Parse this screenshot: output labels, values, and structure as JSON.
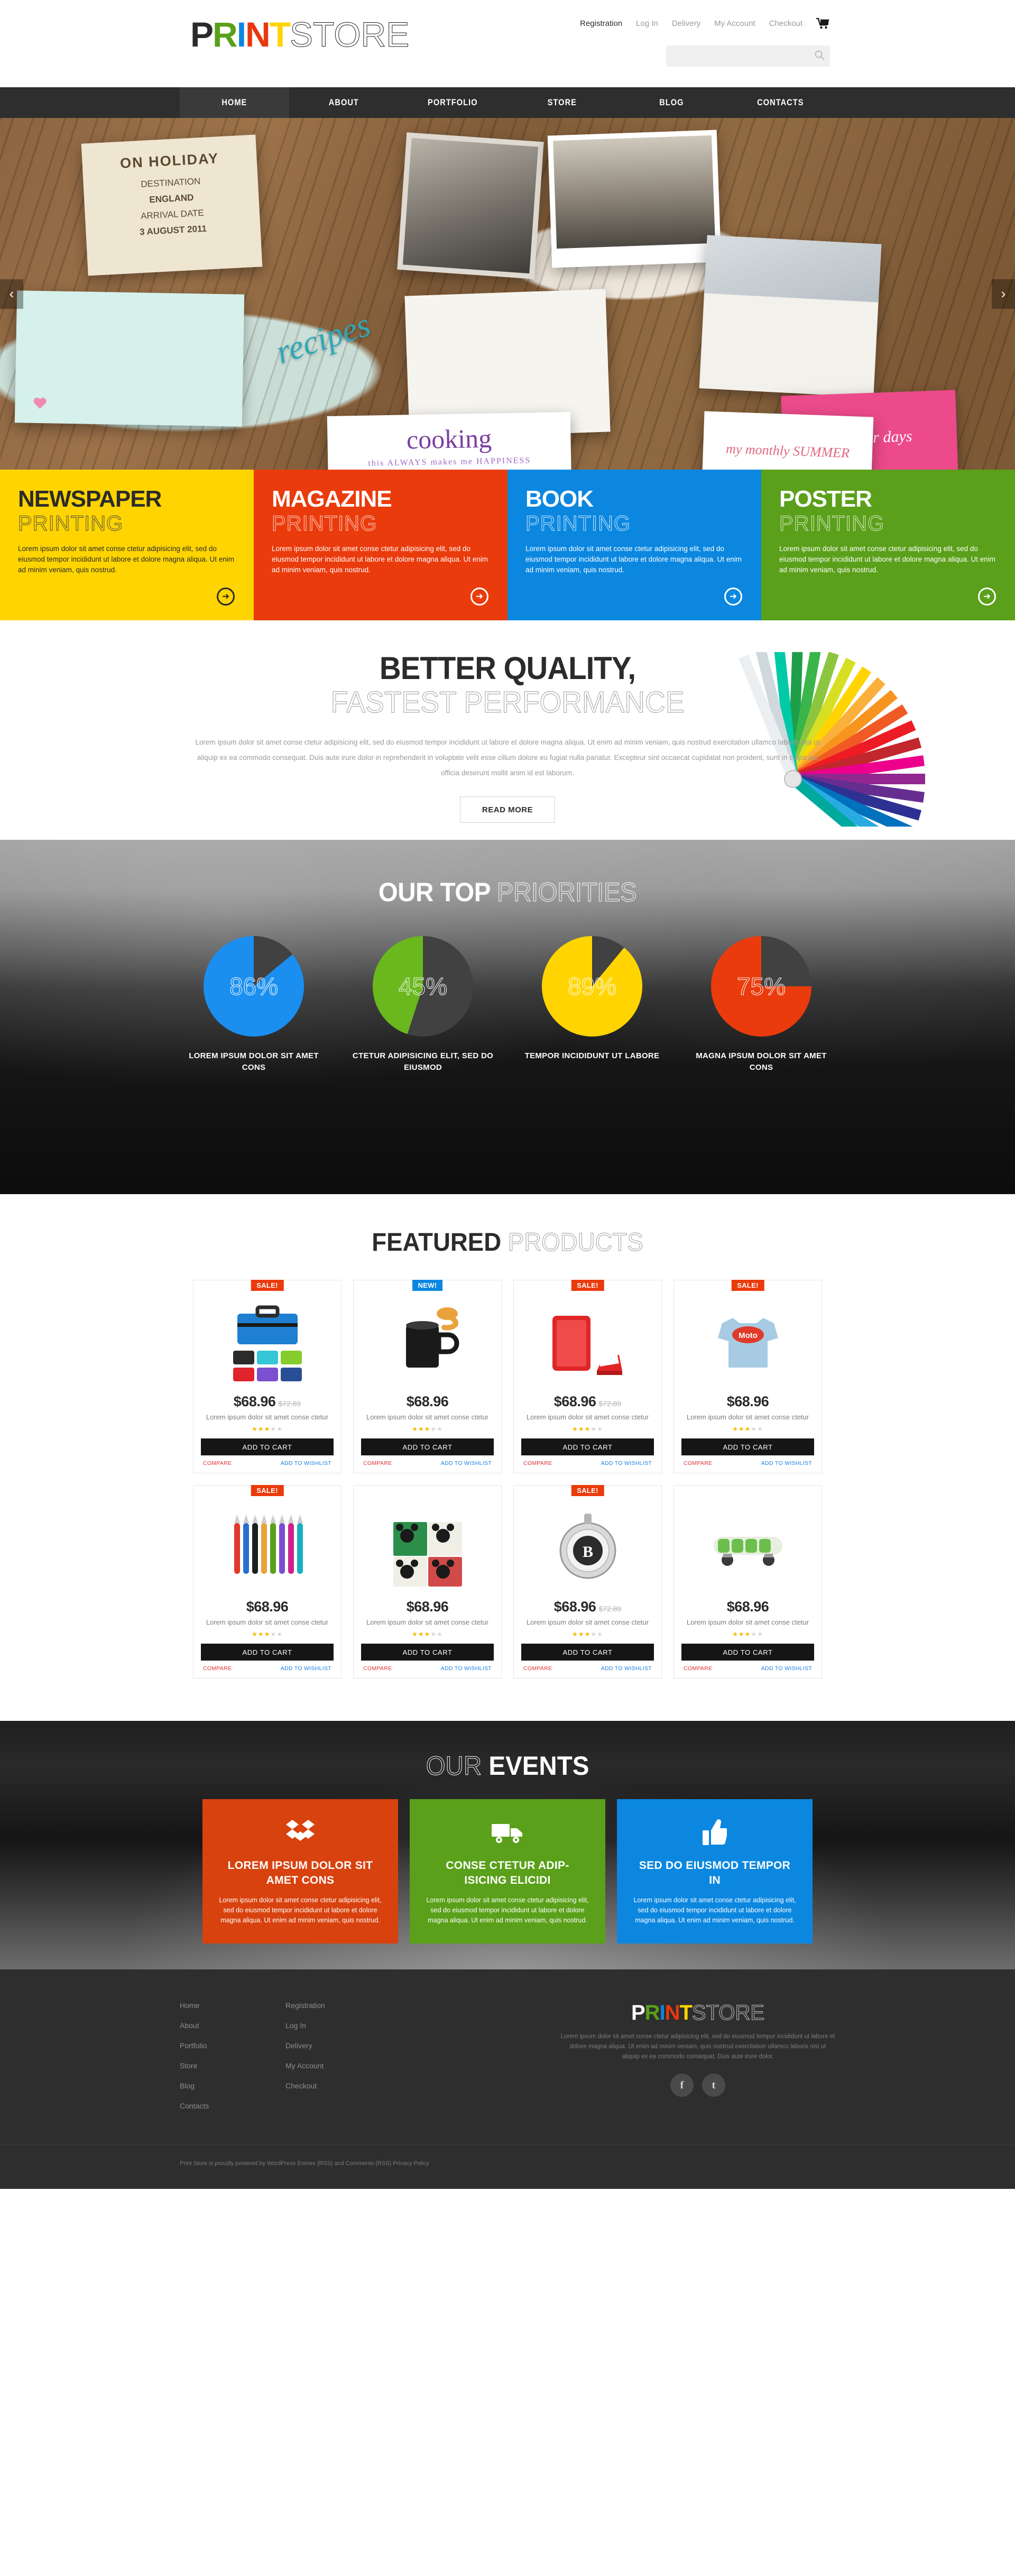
{
  "brand": {
    "p": "P",
    "r": "R",
    "i": "I",
    "n": "N",
    "t": "T",
    "store": "STORE"
  },
  "header": {
    "top_links": [
      {
        "label": "Registration",
        "active": true
      },
      {
        "label": "Log In",
        "active": false
      },
      {
        "label": "Delivery",
        "active": false
      },
      {
        "label": "My Account",
        "active": false
      },
      {
        "label": "Checkout",
        "active": false
      }
    ],
    "cart_icon": "shopping-cart-icon",
    "search": {
      "value": "",
      "placeholder": "",
      "icon": "search-icon"
    }
  },
  "nav": {
    "items": [
      {
        "label": "HOME",
        "active": true
      },
      {
        "label": "ABOUT",
        "active": false
      },
      {
        "label": "PORTFOLIO",
        "active": false
      },
      {
        "label": "STORE",
        "active": false
      },
      {
        "label": "BLOG",
        "active": false
      },
      {
        "label": "CONTACTS",
        "active": false
      }
    ]
  },
  "slider": {
    "prev_icon": "chevron-left-icon",
    "next_icon": "chevron-right-icon",
    "card_on_holiday": {
      "line1": "ON HOLIDAY",
      "line2": "DESTINATION",
      "line3": "ENGLAND",
      "line4": "ARRIVAL DATE",
      "line5": "3 AUGUST 2011"
    },
    "cooking": "cooking",
    "cooking_sub": "this ALWAYS makes me HAPPINESS",
    "recipes": "recipes",
    "summer_note": "my monthly SUMMER",
    "pink_note": "Summer days"
  },
  "promos": [
    {
      "color": "#ffd400",
      "theme": "yellow",
      "title": "NEWSPAPER",
      "subtitle": "PRINTING",
      "text": "Lorem ipsum dolor sit amet conse ctetur adipisicing elit, sed do eiusmod tempor incididunt ut labore et dolore magna aliqua. Ut enim ad minim veniam, quis nostrud.",
      "arrow_icon": "arrow-right-circle-icon"
    },
    {
      "color": "#ea3b0c",
      "theme": "red",
      "title": "MAGAZINE",
      "subtitle": "PRINTING",
      "text": "Lorem ipsum dolor sit amet conse ctetur adipisicing elit, sed do eiusmod tempor incididunt ut labore et dolore magna aliqua. Ut enim ad minim veniam, quis nostrud.",
      "arrow_icon": "arrow-right-circle-icon"
    },
    {
      "color": "#0b87e0",
      "theme": "blue",
      "title": "BOOK",
      "subtitle": "PRINTING",
      "text": "Lorem ipsum dolor sit amet conse ctetur adipisicing elit, sed do eiusmod tempor incididunt ut labore et dolore magna aliqua. Ut enim ad minim veniam, quis nostrud.",
      "arrow_icon": "arrow-right-circle-icon"
    },
    {
      "color": "#5aa01a",
      "theme": "green",
      "title": "POSTER",
      "subtitle": "PRINTING",
      "text": "Lorem ipsum dolor sit amet conse ctetur adipisicing elit, sed do eiusmod tempor incididunt ut labore et dolore magna aliqua. Ut enim ad minim veniam, quis nostrud.",
      "arrow_icon": "arrow-right-circle-icon"
    }
  ],
  "quality": {
    "title": "BETTER QUALITY,",
    "subtitle": "FASTEST PERFORMANCE",
    "text": "Lorem ipsum dolor sit amet conse ctetur adipisicing elit, sed do eiusmod tempor incididunt ut labore et dolore magna aliqua. Ut enim ad minim veniam, quis nostrud exercitation ullamco laboris nisi ut aliquip ex ea commodo consequat. Duis aute irure dolor in reprehenderit in voluptate velit esse cillum dolore eu fugiat nulla pariatur. Excepteur sint occaecat cupidatat non proident, sunt in culpa qui officia deserunt mollit anim id est laborum.",
    "button": "READ MORE"
  },
  "priorities": {
    "title_bold": "OUR TOP",
    "title_thin": "PRIORITIES"
  },
  "chart_data": [
    {
      "type": "pie",
      "title": "LOREM IPSUM DOLOR SIT AMET CONS",
      "categories": [
        "completed",
        "remaining"
      ],
      "values": [
        86,
        14
      ],
      "label": "86%",
      "color": "#1a8ff0",
      "rest_color": "#414141"
    },
    {
      "type": "pie",
      "title": "CTETUR ADIPISICING ELIT, SED DO EIUSMOD",
      "categories": [
        "completed",
        "remaining"
      ],
      "values": [
        45,
        55
      ],
      "label": "45%",
      "color": "#6ab81e",
      "rest_color": "#414141"
    },
    {
      "type": "pie",
      "title": "TEMPOR INCIDIDUNT UT LABORE",
      "categories": [
        "completed",
        "remaining"
      ],
      "values": [
        89,
        11
      ],
      "label": "89%",
      "color": "#ffd400",
      "rest_color": "#414141"
    },
    {
      "type": "pie",
      "title": "MAGNA IPSUM DOLOR SIT AMET CONS",
      "categories": [
        "completed",
        "remaining"
      ],
      "values": [
        75,
        25
      ],
      "label": "75%",
      "color": "#ea3b0c",
      "rest_color": "#414141"
    }
  ],
  "featured": {
    "title_bold": "FEATURED",
    "title_thin": "PRODUCTS",
    "add_to_cart": "ADD TO CART",
    "compare": "COMPARE",
    "wishlist": "ADD TO WISHLIST",
    "products": [
      {
        "badge": "SALE!",
        "badge_type": "sale",
        "price": "$68.96",
        "old_price": "$72.89",
        "desc": "Lorem ipsum dolor sit amet conse ctetur",
        "rating": 3,
        "art": "bag"
      },
      {
        "badge": "NEW!",
        "badge_type": "new",
        "price": "$68.96",
        "old_price": "",
        "desc": "Lorem ipsum dolor sit amet conse ctetur",
        "rating": 3,
        "art": "mug"
      },
      {
        "badge": "SALE!",
        "badge_type": "sale",
        "price": "$68.96",
        "old_price": "$72.89",
        "desc": "Lorem ipsum dolor sit amet conse ctetur",
        "rating": 3,
        "art": "case"
      },
      {
        "badge": "SALE!",
        "badge_type": "sale",
        "price": "$68.96",
        "old_price": "",
        "desc": "Lorem ipsum dolor sit amet conse ctetur",
        "rating": 3,
        "art": "shirt"
      },
      {
        "badge": "SALE!",
        "badge_type": "sale",
        "price": "$68.96",
        "old_price": "",
        "desc": "Lorem ipsum dolor sit amet conse ctetur",
        "rating": 3,
        "art": "pens"
      },
      {
        "badge": "",
        "badge_type": "",
        "price": "$68.96",
        "old_price": "",
        "desc": "Lorem ipsum dolor sit amet conse ctetur",
        "rating": 3,
        "art": "napkins"
      },
      {
        "badge": "SALE!",
        "badge_type": "sale",
        "price": "$68.96",
        "old_price": "$72.89",
        "desc": "Lorem ipsum dolor sit amet conse ctetur",
        "rating": 3,
        "art": "medal"
      },
      {
        "badge": "",
        "badge_type": "",
        "price": "$68.96",
        "old_price": "",
        "desc": "Lorem ipsum dolor sit amet conse ctetur",
        "rating": 3,
        "art": "board"
      }
    ]
  },
  "events": {
    "title_thin": "OUR",
    "title_bold": "EVENTS",
    "cards": [
      {
        "theme": "red",
        "icon": "dropbox-icon",
        "title": "LOREM IPSUM DOLOR SIT AMET CONS",
        "text": "Lorem ipsum dolor sit amet conse ctetur adipisicing elit, sed do eiusmod tempor incididunt ut labore et dolore magna aliqua. Ut enim ad minim veniam, quis nostrud."
      },
      {
        "theme": "green",
        "icon": "truck-icon",
        "title": "CONSE CTETUR ADIP-ISICING ELICIDI",
        "text": "Lorem ipsum dolor sit amet conse ctetur adipisicing elit, sed do eiusmod tempor incididunt ut labore et dolore magna aliqua. Ut enim ad minim veniam, quis nostrud."
      },
      {
        "theme": "blue",
        "icon": "thumbs-up-icon",
        "title": "SED DO EIUSMOD TEMPOR IN",
        "text": "Lorem ipsum dolor sit amet conse ctetur adipisicing elit, sed do eiusmod tempor incididunt ut labore et dolore magna aliqua. Ut enim ad minim veniam, quis nostrud."
      }
    ]
  },
  "footer": {
    "col1": [
      "Home",
      "About",
      "Portfolio",
      "Store",
      "Blog",
      "Contacts"
    ],
    "col2": [
      "Registration",
      "Log In",
      "Delivery",
      "My Account",
      "Checkout"
    ],
    "about_text": "Lorem ipsum dolor sit amet conse ctetur adipisicing elit, sed do eiusmod tempor incididunt ut labore et dolore magna aliqua. Ut enim ad minim veniam, quis nostrud exercitation ullamco laboris nisi ut aliquip ex ea commodo consequat. Duis aute irure dolor.",
    "social": [
      {
        "icon": "facebook-icon",
        "glyph": "f"
      },
      {
        "icon": "twitter-icon",
        "glyph": "t"
      }
    ],
    "copyright": "Print Store is proudly powered by WordPress Entries (RSS) and Comments (RSS) Privacy Policy"
  }
}
